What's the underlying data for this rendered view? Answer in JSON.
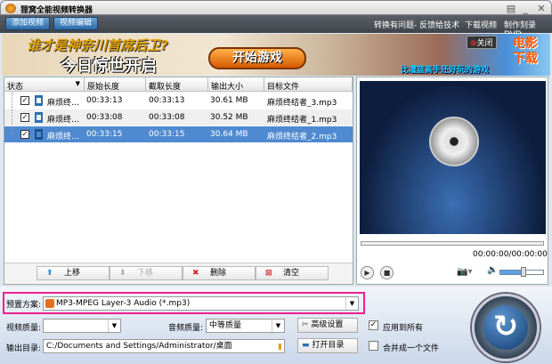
{
  "window": {
    "title": "狸窝全能视频转换器",
    "controls": [
      "▤",
      "_",
      "✕"
    ]
  },
  "toolbar": {
    "add_video": "添加视频",
    "edit_video": "视频编辑",
    "links": [
      "转换有问题- 反馈给技术",
      "下载视频",
      "制作刻录DVD"
    ]
  },
  "banner": {
    "line1": "谁才是神奈川首席后卫?",
    "line2": "今日惊世开启",
    "start": "开始游戏",
    "tagline": "比灌篮高手还好玩的游戏",
    "close": "关闭",
    "side": "电影下载"
  },
  "table": {
    "headers": [
      "状态",
      "原始长度",
      "截取长度",
      "输出大小",
      "目标文件"
    ],
    "rows": [
      {
        "name": "麻烦终…",
        "orig": "00:33:13",
        "clip": "00:33:13",
        "size": "30.61 MB",
        "target": "麻烦终结者_3.mp3",
        "checked": true,
        "selected": false
      },
      {
        "name": "麻烦终…",
        "orig": "00:33:08",
        "clip": "00:33:08",
        "size": "30.52 MB",
        "target": "麻烦终结者_1.mp3",
        "checked": true,
        "selected": false
      },
      {
        "name": "麻烦终…",
        "orig": "00:33:15",
        "clip": "00:33:15",
        "size": "30.64 MB",
        "target": "麻烦终结者_2.mp3",
        "checked": true,
        "selected": true
      }
    ]
  },
  "list_buttons": {
    "up": "上移",
    "down": "下移",
    "delete": "删除",
    "clear": "清空"
  },
  "player": {
    "time": "00:00:00/00:00:00",
    "volume_percent": 55,
    "seek_percent": 0
  },
  "settings": {
    "preset_label": "预置方案:",
    "preset_value": "MP3-MPEG Layer-3 Audio (*.mp3)",
    "video_quality_label": "视频质量:",
    "video_quality_value": "",
    "audio_quality_label": "音频质量:",
    "audio_quality_value": "中等质量",
    "advanced": "高级设置",
    "apply_all": "应用到所有",
    "apply_all_checked": true,
    "output_label": "输出目录:",
    "output_value": "C:/Documents and Settings/Administrator/桌面",
    "open_dir": "打开目录",
    "merge": "合并成一个文件",
    "merge_checked": false
  },
  "colors": {
    "highlight": "#ee1f8f",
    "selection": "#4f8ad1"
  }
}
